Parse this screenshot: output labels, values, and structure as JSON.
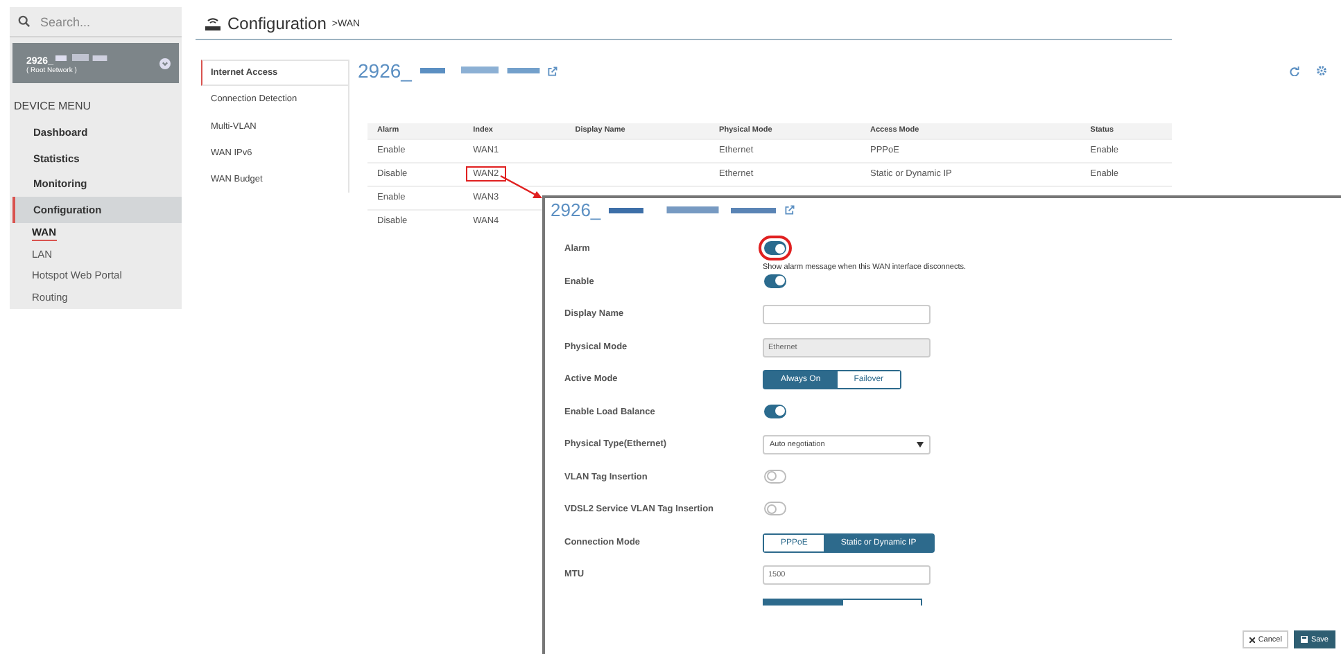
{
  "search": {
    "placeholder": "Search..."
  },
  "device": {
    "name": "2926_",
    "network": "( Root Network )"
  },
  "menu_heading": "DEVICE MENU",
  "menu": [
    {
      "label": "Dashboard",
      "selected": false
    },
    {
      "label": "Statistics",
      "selected": false
    },
    {
      "label": "Monitoring",
      "selected": false
    },
    {
      "label": "Configuration",
      "selected": true,
      "children": [
        {
          "label": "WAN",
          "selected": true
        },
        {
          "label": "LAN",
          "selected": false
        },
        {
          "label": "Hotspot Web Portal",
          "selected": false
        },
        {
          "label": "Routing",
          "selected": false
        }
      ]
    }
  ],
  "header": {
    "title": "Configuration",
    "crumb": ">WAN"
  },
  "tabs": [
    {
      "label": "Internet Access",
      "selected": true
    },
    {
      "label": "Connection Detection",
      "selected": false
    },
    {
      "label": "Multi-VLAN",
      "selected": false
    },
    {
      "label": "WAN IPv6",
      "selected": false
    },
    {
      "label": "WAN Budget",
      "selected": false
    }
  ],
  "device_title": "2926_",
  "table": {
    "columns": [
      "Alarm",
      "Index",
      "Display Name",
      "Physical Mode",
      "Access Mode",
      "Status"
    ],
    "rows": [
      {
        "cells": [
          "Enable",
          "WAN1",
          "",
          "Ethernet",
          "PPPoE",
          "Enable"
        ],
        "highlighted": false
      },
      {
        "cells": [
          "Disable",
          "WAN2",
          "",
          "Ethernet",
          "Static or Dynamic IP",
          "Enable"
        ],
        "highlighted": true
      },
      {
        "cells": [
          "Enable",
          "WAN3"
        ],
        "highlighted": false
      },
      {
        "cells": [
          "Disable",
          "WAN4"
        ],
        "highlighted": false
      }
    ]
  },
  "popup": {
    "title": "2926_",
    "fields": [
      {
        "kind": "toggle",
        "label": "Alarm",
        "on": true,
        "highlighted": true,
        "help": "Show alarm message when this WAN interface disconnects."
      },
      {
        "kind": "toggle",
        "label": "Enable",
        "on": true
      },
      {
        "kind": "text",
        "label": "Display Name"
      },
      {
        "kind": "readonly",
        "label": "Physical Mode",
        "value": "Ethernet"
      },
      {
        "kind": "segmented",
        "label": "Active Mode",
        "options": [
          {
            "label": "Always On",
            "selected": true
          },
          {
            "label": "Failover",
            "selected": false
          }
        ]
      },
      {
        "kind": "toggle",
        "label": "Enable Load Balance",
        "on": true
      },
      {
        "kind": "select",
        "label": "Physical Type(Ethernet)",
        "value": "Auto negotiation"
      },
      {
        "kind": "toggle",
        "label": "VLAN Tag Insertion",
        "on": false
      },
      {
        "kind": "toggle",
        "label": "VDSL2 Service VLAN Tag Insertion",
        "on": false
      },
      {
        "kind": "segmented",
        "label": "Connection Mode",
        "options": [
          {
            "label": "PPPoE",
            "selected": false
          },
          {
            "label": "Static or Dynamic IP",
            "selected": true
          }
        ]
      },
      {
        "kind": "text",
        "label": "MTU",
        "value": "1500"
      },
      {
        "kind": "partial",
        "options": [
          {
            "selected": true
          },
          {
            "selected": false
          }
        ]
      }
    ],
    "buttons": [
      {
        "kind": "cancel",
        "label": "Cancel"
      },
      {
        "kind": "save",
        "label": "Save"
      }
    ]
  }
}
